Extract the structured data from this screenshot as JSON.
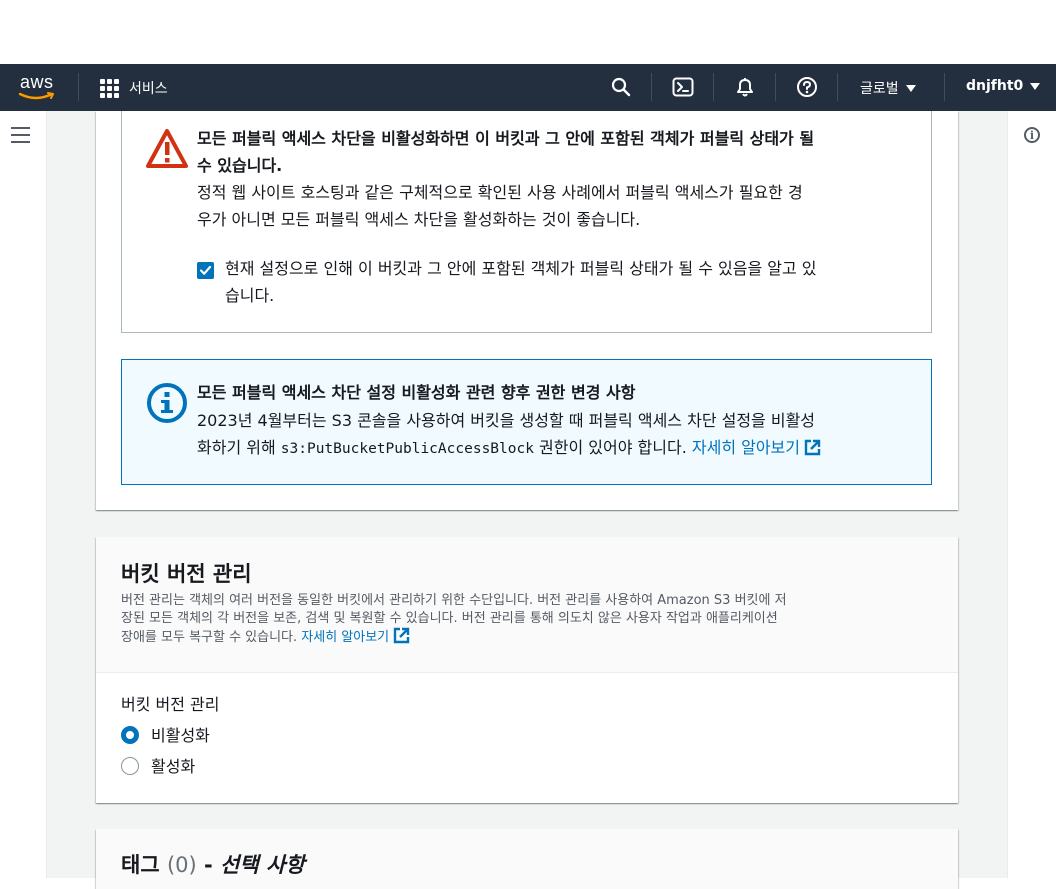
{
  "nav": {
    "logo_text": "aws",
    "services_label": "서비스",
    "region_label": "글로벌",
    "account_label": "dnjfht0"
  },
  "public_warning": {
    "title": "모든 퍼블릭 액세스 차단을 비활성화하면 이 버킷과 그 안에 포함된 객체가 퍼블릭 상태가 될 수 있습니다.",
    "title_line1": "모든 퍼블릭 액세스 차단을 비활성화하면 이 버킷과 그 안에 포함된 객체가 퍼블릭 상태가 될",
    "title_line2": "수 있습니다.",
    "body_line1": "정적 웹 사이트 호스팅과 같은 구체적으로 확인된 사용 사례에서 퍼블릭 액세스가 필요한 경",
    "body_line2": "우가 아니면 모든 퍼블릭 액세스 차단을 활성화하는 것이 좋습니다.",
    "ack_checked": true,
    "ack_line1": "현재 설정으로 인해 이 버킷과 그 안에 포함된 객체가 퍼블릭 상태가 될 수 있음을 알고 있",
    "ack_line2": "습니다."
  },
  "info_notice": {
    "title": "모든 퍼블릭 액세스 차단 설정 비활성화 관련 향후 권한 변경 사항",
    "body_line1": "2023년 4월부터는 S3 콘솔을 사용하여 버킷을 생성할 때 퍼블릭 액세스 차단 설정을 비활성",
    "body_line2_pre": "화하기 위해 ",
    "body_line2_code": "s3:PutBucketPublicAccessBlock",
    "body_line2_post": " 권한이 있어야 합니다. ",
    "learn_more": "자세히 알아보기"
  },
  "versioning": {
    "title": "버킷 버전 관리",
    "desc_line1": "버전 관리는 객체의 여러 버전을 동일한 버킷에서 관리하기 위한 수단입니다. 버전 관리를 사용하여 Amazon S3 버킷에 저",
    "desc_line2": "장된 모든 객체의 각 버전을 보존, 검색 및 복원할 수 있습니다. 버전 관리를 통해 의도치 않은 사용자 작업과 애플리케이션",
    "desc_line3": "장애를 모두 복구할 수 있습니다. ",
    "learn_more": "자세히 알아보기",
    "field_label": "버킷 버전 관리",
    "options": [
      "비활성화",
      "활성화"
    ],
    "selected": "비활성화"
  },
  "tags": {
    "title": "태그",
    "count": "(0)",
    "dash": " - ",
    "optional": "선택 사항"
  },
  "colors": {
    "nav_bg": "#232f3e",
    "link": "#0073bb",
    "warning": "#d13212",
    "info": "#0073bb",
    "page_bg": "#f2f3f3"
  }
}
